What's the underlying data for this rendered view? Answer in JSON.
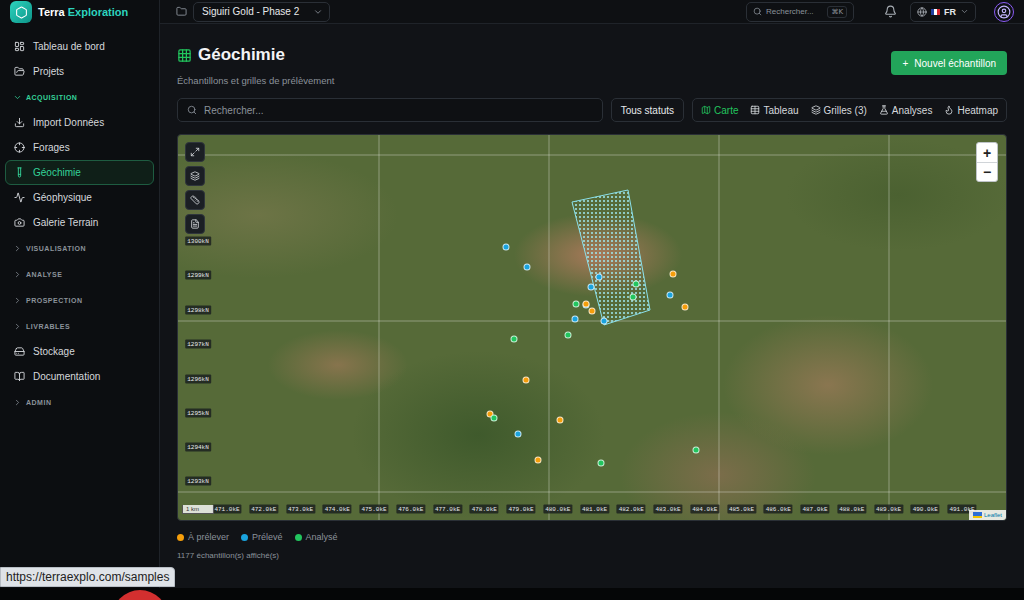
{
  "brand": {
    "first": "Terra",
    "second": "Exploration"
  },
  "topbar": {
    "project": "Siguiri Gold - Phase 2",
    "search_placeholder": "Rechercher...",
    "search_shortcut": "⌘K",
    "language": "FR"
  },
  "sidebar": {
    "items": [
      {
        "kind": "item",
        "label": "Tableau de bord",
        "selected": false
      },
      {
        "kind": "item",
        "label": "Projets",
        "selected": false
      },
      {
        "kind": "section",
        "label": "ACQUISITION",
        "expanded": true
      },
      {
        "kind": "item",
        "label": "Import Données",
        "selected": false
      },
      {
        "kind": "item",
        "label": "Forages",
        "selected": false
      },
      {
        "kind": "item",
        "label": "Géochimie",
        "selected": true
      },
      {
        "kind": "item",
        "label": "Géophysique",
        "selected": false
      },
      {
        "kind": "item",
        "label": "Galerie Terrain",
        "selected": false
      },
      {
        "kind": "section",
        "label": "VISUALISATION",
        "expanded": false
      },
      {
        "kind": "section",
        "label": "ANALYSE",
        "expanded": false
      },
      {
        "kind": "section",
        "label": "PROSPECTION",
        "expanded": false
      },
      {
        "kind": "section",
        "label": "LIVRABLES",
        "expanded": false
      },
      {
        "kind": "item",
        "label": "Stockage",
        "selected": false
      },
      {
        "kind": "item",
        "label": "Documentation",
        "selected": false
      },
      {
        "kind": "section",
        "label": "ADMIN",
        "expanded": false
      }
    ]
  },
  "page": {
    "title": "Géochimie",
    "subtitle": "Échantillons et grilles de prélèvement",
    "new_button_icon": "+",
    "new_button": "Nouvel échantillon"
  },
  "toolbar": {
    "search_placeholder": "Rechercher...",
    "status_filter": "Tous statuts",
    "views": [
      {
        "label": "Carte",
        "selected": true
      },
      {
        "label": "Tableau",
        "selected": false
      },
      {
        "label": "Grilles (3)",
        "selected": false
      },
      {
        "label": "Analyses",
        "selected": false
      },
      {
        "label": "Heatmap",
        "selected": false
      }
    ]
  },
  "map": {
    "zoom_in": "+",
    "zoom_out": "−",
    "scale": "1 km",
    "attribution": "Leaflet",
    "y_labels": [
      "1300kN",
      "1299kN",
      "1298kN",
      "1297kN",
      "1296kN",
      "1295kN",
      "1294kN",
      "1293kN"
    ],
    "x_labels": [
      "471.0kE",
      "472.0kE",
      "473.0kE",
      "474.0kE",
      "475.0kE",
      "476.0kE",
      "477.0kE",
      "478.0kE",
      "479.0kE",
      "480.0kE",
      "481.0kE",
      "482.0kE",
      "483.0kE",
      "484.0kE",
      "485.0kE",
      "486.0kE",
      "487.0kE",
      "488.0kE",
      "489.0kE",
      "490.0kE",
      "491.0kE"
    ],
    "markers": [
      {
        "color": "#1aa3de"
      },
      {
        "color": "#1aa3de"
      },
      {
        "color": "#1aa3de"
      },
      {
        "color": "#1aa3de"
      },
      {
        "color": "#1aa3de"
      },
      {
        "color": "#1aa3de"
      },
      {
        "color": "#1aa3de"
      },
      {
        "color": "#1aa3de"
      },
      {
        "color": "#1aa3de"
      },
      {
        "color": "#f59e0b"
      },
      {
        "color": "#f59e0b"
      },
      {
        "color": "#f59e0b"
      },
      {
        "color": "#f59e0b"
      },
      {
        "color": "#f59e0b"
      },
      {
        "color": "#f59e0b"
      },
      {
        "color": "#f59e0b"
      },
      {
        "color": "#f59e0b"
      },
      {
        "color": "#22c55e"
      },
      {
        "color": "#22c55e"
      },
      {
        "color": "#22c55e"
      },
      {
        "color": "#22c55e"
      },
      {
        "color": "#22c55e"
      },
      {
        "color": "#22c55e"
      },
      {
        "color": "#22c55e"
      },
      {
        "color": "#22c55e"
      }
    ]
  },
  "legend": [
    {
      "label": "À prélever",
      "color": "#f59e0b"
    },
    {
      "label": "Prélevé",
      "color": "#1aa3de"
    },
    {
      "label": "Analysé",
      "color": "#22c55e"
    }
  ],
  "count": "1177 échantillon(s) affiché(s)",
  "status_url": "https://terraexplo.com/samples"
}
